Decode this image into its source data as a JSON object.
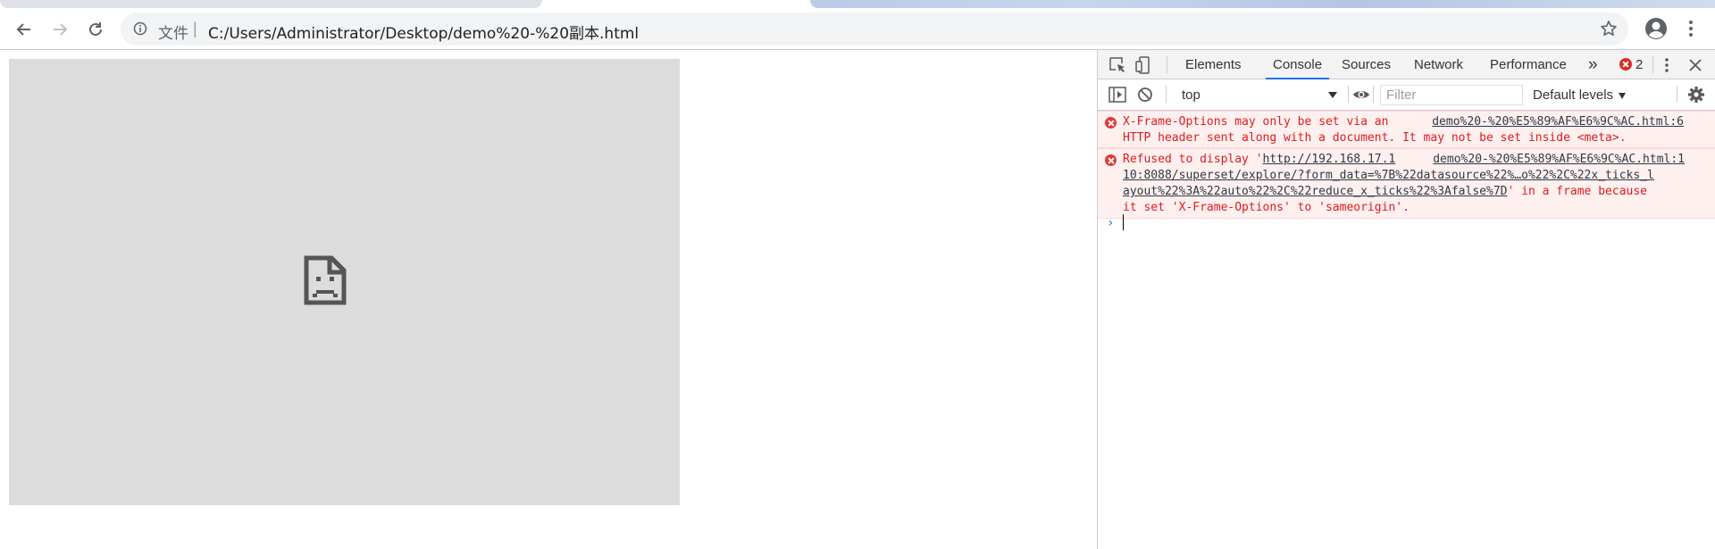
{
  "browser": {
    "address": {
      "scheme_label": "文件",
      "separator": "|",
      "url": "C:/Users/Administrator/Desktop/demo%20-%20副本.html"
    },
    "icons": {
      "back": "back-arrow-icon",
      "forward": "forward-arrow-icon",
      "reload": "reload-icon",
      "info": "info-icon",
      "bookmark": "star-icon",
      "profile": "profile-icon",
      "menu": "kebab-menu-icon"
    }
  },
  "page": {
    "frame_error_icon": "sad-document-icon",
    "frame_bg": "#dcdcdc"
  },
  "devtools": {
    "tabs": {
      "elements": "Elements",
      "console": "Console",
      "sources": "Sources",
      "network": "Network",
      "performance": "Performance",
      "more": "»"
    },
    "error_count": "2",
    "console_bar": {
      "context": "top",
      "filter_placeholder": "Filter",
      "levels": "Default levels"
    },
    "messages": [
      {
        "line1": "X-Frame-Options may only be set via an",
        "source": "demo%20-%20%E5%89%AF%E6%9C%AC.html:6",
        "line2": "HTTP header sent along with a document. It may not be set inside <meta>."
      },
      {
        "prefix": "Refused to display '",
        "link_part1": "http://192.168.17.1",
        "source": "demo%20-%20%E5%89%AF%E6%9C%AC.html:1",
        "link_part2": "10:8088/superset/explore/?form_data=%7B%22datasource%22%…o%22%2C%22x_ticks_l",
        "link_part3": "ayout%22%3A%22auto%22%2C%22reduce_x_ticks%22%3Afalse%7D",
        "suffix3": "' in a frame because",
        "line4": "it set 'X-Frame-Options' to 'sameorigin'."
      }
    ],
    "prompt": "›",
    "colors": {
      "error_text": "#e01b1b",
      "error_bg": "#fff0f0",
      "active_tab": "#1a73e8"
    }
  }
}
